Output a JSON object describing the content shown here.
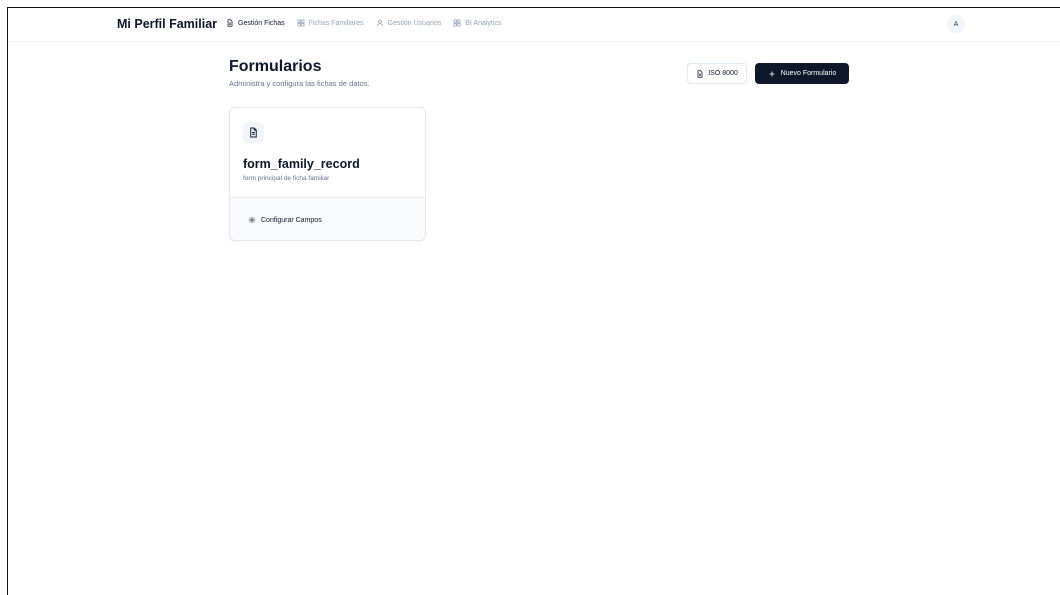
{
  "header": {
    "brand": "Mi Perfil Familiar",
    "nav": [
      {
        "label": "Gestión Fichas",
        "icon": "document-icon",
        "active": true
      },
      {
        "label": "Fichas Familiares",
        "icon": "grid-icon",
        "active": false
      },
      {
        "label": "Gestión Usuarios",
        "icon": "user-icon",
        "active": false
      },
      {
        "label": "BI Analytics",
        "icon": "grid-icon",
        "active": false
      }
    ],
    "avatar_initial": "A"
  },
  "page": {
    "title": "Formularios",
    "subtitle": "Administra y configura las fichas de datos.",
    "iso_button": "ISO 8000",
    "new_button": "Nuevo Formulario"
  },
  "forms": [
    {
      "name": "form_family_record",
      "description": "form principal de ficha familiar",
      "action": "Configurar Campos"
    }
  ],
  "colors": {
    "primary": "#0f172a",
    "muted": "#64748b",
    "nav_inactive": "#94a3b8"
  }
}
